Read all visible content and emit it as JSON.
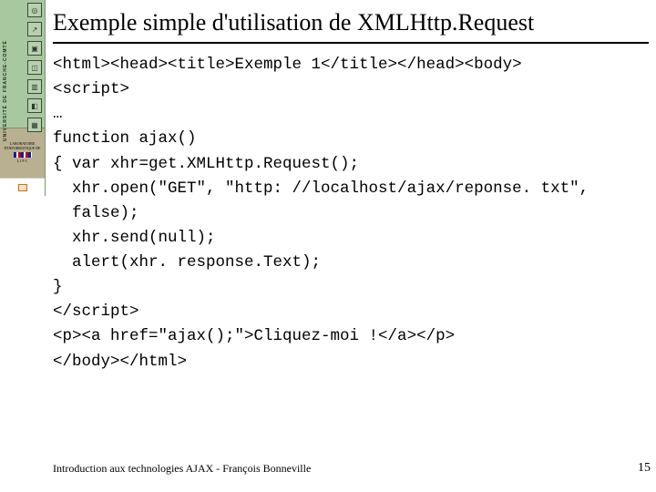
{
  "sidebar": {
    "vertical_label": "UNIVERSITÉ DE FRANCHE-COMTÉ",
    "icons": [
      "◎",
      "↗",
      "▣",
      "◫",
      "▥",
      "◧",
      "▦"
    ],
    "logo_text": "LABORATOIRE D'INFORMATIQUE DE",
    "logo_abbrev": "L I F C"
  },
  "slide": {
    "title": "Exemple simple d'utilisation de XMLHttp.Request",
    "code_lines": [
      "<html><head><title>Exemple 1</title></head><body>",
      "<script>",
      "…",
      "function ajax()",
      "{ var xhr=get.XMLHttp.Request();",
      "  xhr.open(\"GET\", \"http: //localhost/ajax/reponse. txt\",",
      "  false);",
      "  xhr.send(null);",
      "  alert(xhr. response.Text);",
      "}",
      "</script>",
      "<p><a href=\"ajax();\">Cliquez-moi !</a></p>",
      "</body></html>"
    ]
  },
  "footer": {
    "text": "Introduction aux technologies AJAX - François Bonneville",
    "page": "15"
  }
}
